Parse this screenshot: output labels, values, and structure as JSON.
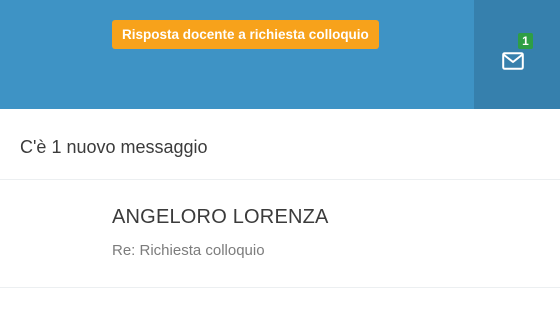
{
  "header": {
    "background_color": "#3e93c5",
    "notification_toast": "Risposta docente a richiesta colloquio",
    "toast_color": "#f7a21b",
    "mail": {
      "icon": "envelope-icon",
      "badge_count": "1",
      "badge_color": "#2e9e45"
    }
  },
  "dropdown": {
    "header_text": "C'è 1 nuovo messaggio",
    "messages": [
      {
        "sender": "ANGELORO LORENZA",
        "subject": "Re: Richiesta colloquio"
      }
    ]
  }
}
